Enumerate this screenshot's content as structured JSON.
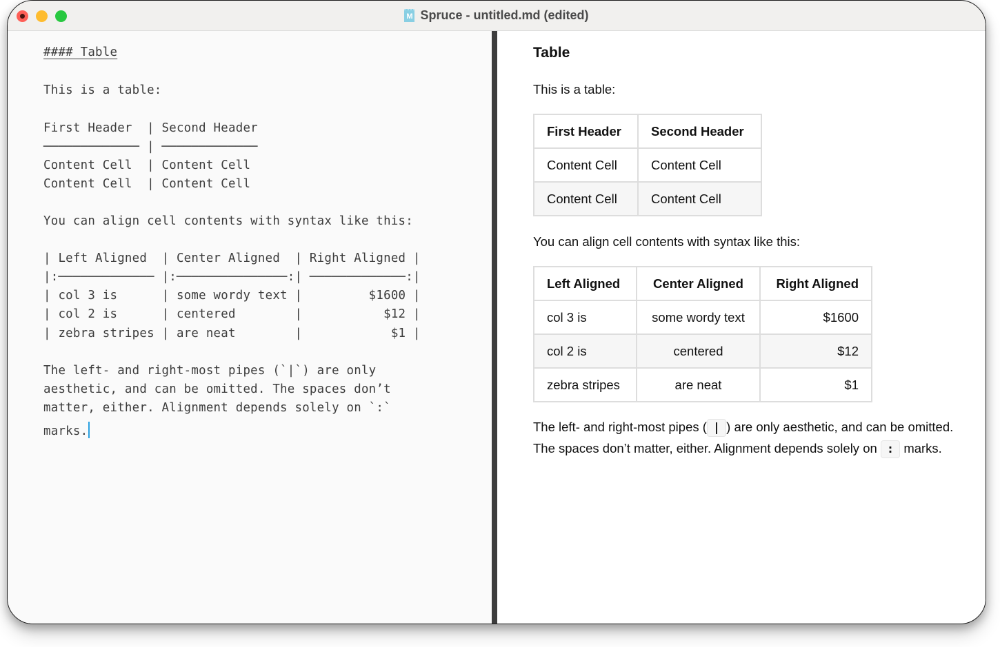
{
  "window": {
    "title": "Spruce - untitled.md (edited)",
    "doc_icon_letter": "M",
    "colors": {
      "close": "#fe5f57",
      "minimize": "#febc2e",
      "maximize": "#28c840",
      "doc_icon": "#89cfe3",
      "cursor": "#2aa0e0",
      "divider": "#3d3d3d"
    }
  },
  "editor": {
    "lines": [
      "#### Table",
      "This is a table:",
      "First Header  | Second Header",
      "───────────── | ─────────────",
      "Content Cell  | Content Cell",
      "Content Cell  | Content Cell",
      "You can align cell contents with syntax like this:",
      "| Left Aligned  | Center Aligned  | Right Aligned |",
      "|:───────────── |:───────────────:| ─────────────:|",
      "| col 3 is      | some wordy text |         $1600 |",
      "| col 2 is      | centered        |           $12 |",
      "| zebra stripes | are neat        |            $1 |",
      "The left- and right-most pipes (`|`) are only",
      "aesthetic, and can be omitted. The spaces don’t",
      "matter, either. Alignment depends solely on `:`",
      "marks."
    ]
  },
  "preview": {
    "heading": "Table",
    "intro": "This is a table:",
    "table1": {
      "headers": [
        "First Header",
        "Second Header"
      ],
      "rows": [
        [
          "Content Cell",
          "Content Cell"
        ],
        [
          "Content Cell",
          "Content Cell"
        ]
      ]
    },
    "align_intro": "You can align cell contents with syntax like this:",
    "table2": {
      "headers": [
        "Left Aligned",
        "Center Aligned",
        "Right Aligned"
      ],
      "rows": [
        [
          "col 3 is",
          "some wordy text",
          "$1600"
        ],
        [
          "col 2 is",
          "centered",
          "$12"
        ],
        [
          "zebra stripes",
          "are neat",
          "$1"
        ]
      ]
    },
    "note": {
      "part1": "The left- and right-most pipes (",
      "code1": "|",
      "part2": ") are only aesthetic, and can be omitted. The spaces don’t matter, either. Alignment depends solely on",
      "code2": ":",
      "part3": "marks."
    }
  }
}
